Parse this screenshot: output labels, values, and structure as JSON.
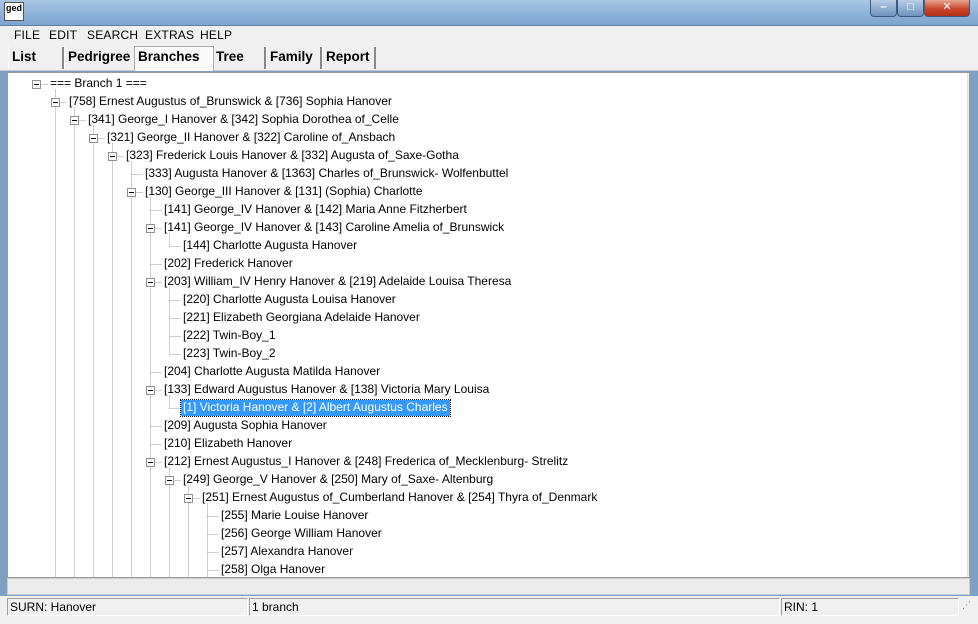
{
  "app": {
    "icon_text": "ged"
  },
  "menu": [
    "FILE",
    "EDIT",
    "SEARCH",
    "EXTRAS",
    "HELP"
  ],
  "tabs": [
    {
      "label": "List",
      "active": false
    },
    {
      "label": "Pedrigree",
      "active": false
    },
    {
      "label": "Branches",
      "active": true
    },
    {
      "label": "Tree",
      "active": false
    },
    {
      "label": "Family",
      "active": false
    },
    {
      "label": "Report",
      "active": false
    }
  ],
  "tree": [
    {
      "text": "=== Branch 1 ===",
      "level": 0,
      "expandable": true
    },
    {
      "text": "[758] Ernest Augustus of_Brunswick  & [736] Sophia  Hanover",
      "level": 1,
      "expandable": true
    },
    {
      "text": "[341] George_I  Hanover & [342] Sophia Dorothea of_Celle",
      "level": 2,
      "expandable": true
    },
    {
      "text": "[321] George_II  Hanover & [322] Caroline of_Ansbach",
      "level": 3,
      "expandable": true
    },
    {
      "text": "[323] Frederick Louis  Hanover & [332] Augusta of_Saxe-Gotha",
      "level": 4,
      "expandable": true
    },
    {
      "text": "[333] Augusta  Hanover & [1363] Charles of_Brunswick- Wolfenbuttel",
      "level": 5,
      "expandable": false
    },
    {
      "text": "[130] George_III  Hanover & [131] (Sophia) Charlotte",
      "level": 5,
      "expandable": true
    },
    {
      "text": "[141] George_IV  Hanover & [142] Maria Anne  Fitzherbert",
      "level": 6,
      "expandable": false
    },
    {
      "text": "[141] George_IV  Hanover & [143] Caroline Amelia of_Brunswick",
      "level": 6,
      "expandable": true
    },
    {
      "text": "[144] Charlotte Augusta  Hanover",
      "level": 7,
      "expandable": false
    },
    {
      "text": "[202] Frederick  Hanover",
      "level": 6,
      "expandable": false
    },
    {
      "text": "[203] William_IV Henry  Hanover & [219] Adelaide Louisa Theresa",
      "level": 6,
      "expandable": true
    },
    {
      "text": "[220] Charlotte Augusta Louisa Hanover",
      "level": 7,
      "expandable": false
    },
    {
      "text": "[221] Elizabeth Georgiana Adelaide Hanover",
      "level": 7,
      "expandable": false
    },
    {
      "text": "[222] Twin-Boy_1",
      "level": 7,
      "expandable": false
    },
    {
      "text": "[223] Twin-Boy_2",
      "level": 7,
      "expandable": false
    },
    {
      "text": "[204] Charlotte Augusta Matilda Hanover",
      "level": 6,
      "expandable": false
    },
    {
      "text": "[133] Edward Augustus  Hanover & [138] Victoria Mary Louisa",
      "level": 6,
      "expandable": true
    },
    {
      "text": "[1] Victoria  Hanover & [2] Albert Augustus Charles",
      "level": 7,
      "expandable": false,
      "selected": true
    },
    {
      "text": "[209] Augusta Sophia  Hanover",
      "level": 6,
      "expandable": false
    },
    {
      "text": "[210] Elizabeth  Hanover",
      "level": 6,
      "expandable": false
    },
    {
      "text": "[212] Ernest Augustus_I  Hanover & [248] Frederica of_Mecklenburg- Strelitz",
      "level": 6,
      "expandable": true
    },
    {
      "text": "[249] George_V  Hanover & [250] Mary of_Saxe- Altenburg",
      "level": 7,
      "expandable": true
    },
    {
      "text": "[251] Ernest Augustus of_Cumberland Hanover & [254] Thyra of_Denmark",
      "level": 8,
      "expandable": true
    },
    {
      "text": "[255] Marie Louise  Hanover",
      "level": 9,
      "expandable": false
    },
    {
      "text": "[256] George William  Hanover",
      "level": 9,
      "expandable": false
    },
    {
      "text": "[257] Alexandra  Hanover",
      "level": 9,
      "expandable": false
    },
    {
      "text": "[258] Olga  Hanover",
      "level": 9,
      "expandable": false
    }
  ],
  "status": {
    "surname": "SURN: Hanover",
    "branches": "1 branch",
    "rin": "RIN: 1"
  }
}
